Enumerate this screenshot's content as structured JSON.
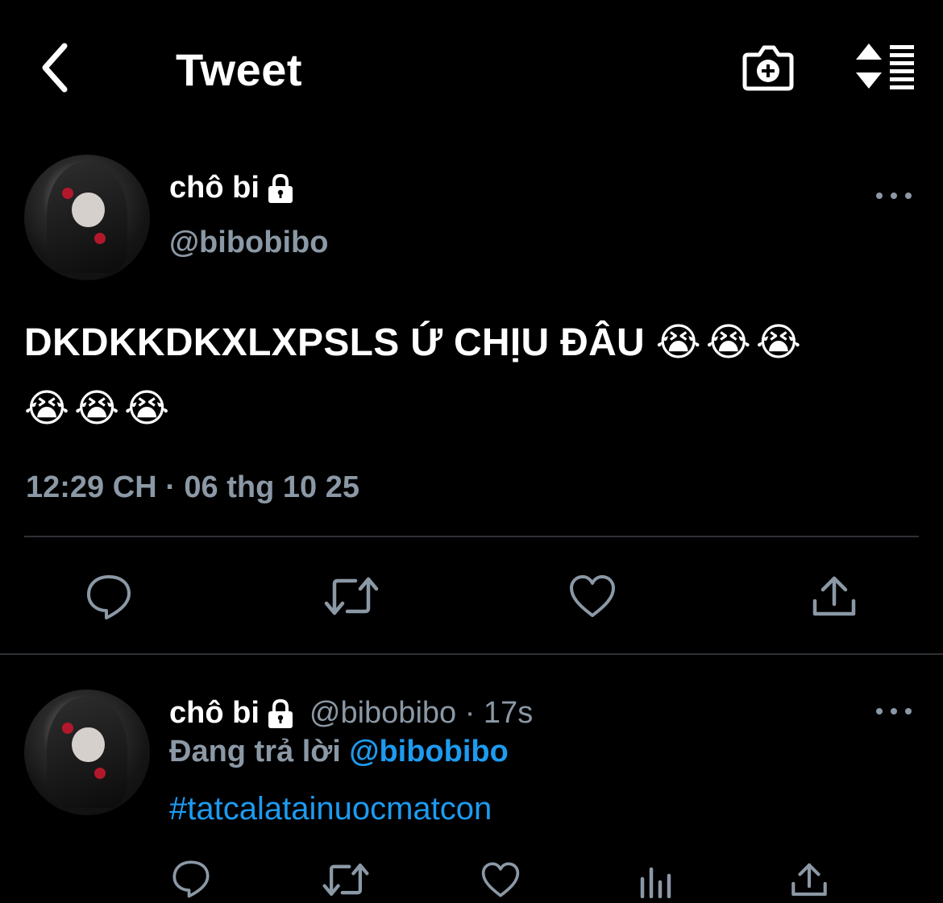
{
  "header": {
    "title": "Tweet",
    "back_icon": "chevron-left-icon",
    "camera_icon": "camera-add-icon",
    "sort_icon": "sort-list-icon"
  },
  "tweet": {
    "author": {
      "name": "chô bi",
      "handle": "@bibobibo",
      "protected_icon": "lock-icon"
    },
    "text": "DKDKKDKXLXPSLS Ứ CHỊU ĐÂU",
    "emojis_line1": "😭😭😭",
    "emojis_line2": "😭😭😭",
    "timestamp": "12:29 CH · 06 thg 10 25",
    "actions": [
      "reply",
      "retweet",
      "like",
      "share"
    ]
  },
  "reply": {
    "author": {
      "name": "chô bi",
      "handle": "@bibobibo",
      "time": "17s"
    },
    "meta": "@bibobibo · 17s",
    "replying_to_label": "Đang trả lời",
    "replying_to_handle": "@bibobibo",
    "text": "#tatcalatainuocmatcon",
    "actions": [
      "reply",
      "retweet",
      "like",
      "analytics",
      "share"
    ]
  },
  "colors": {
    "background": "#000000",
    "text": "#ffffff",
    "secondary": "#8b98a5",
    "accent": "#1d9bf0",
    "divider": "#2f3336"
  }
}
